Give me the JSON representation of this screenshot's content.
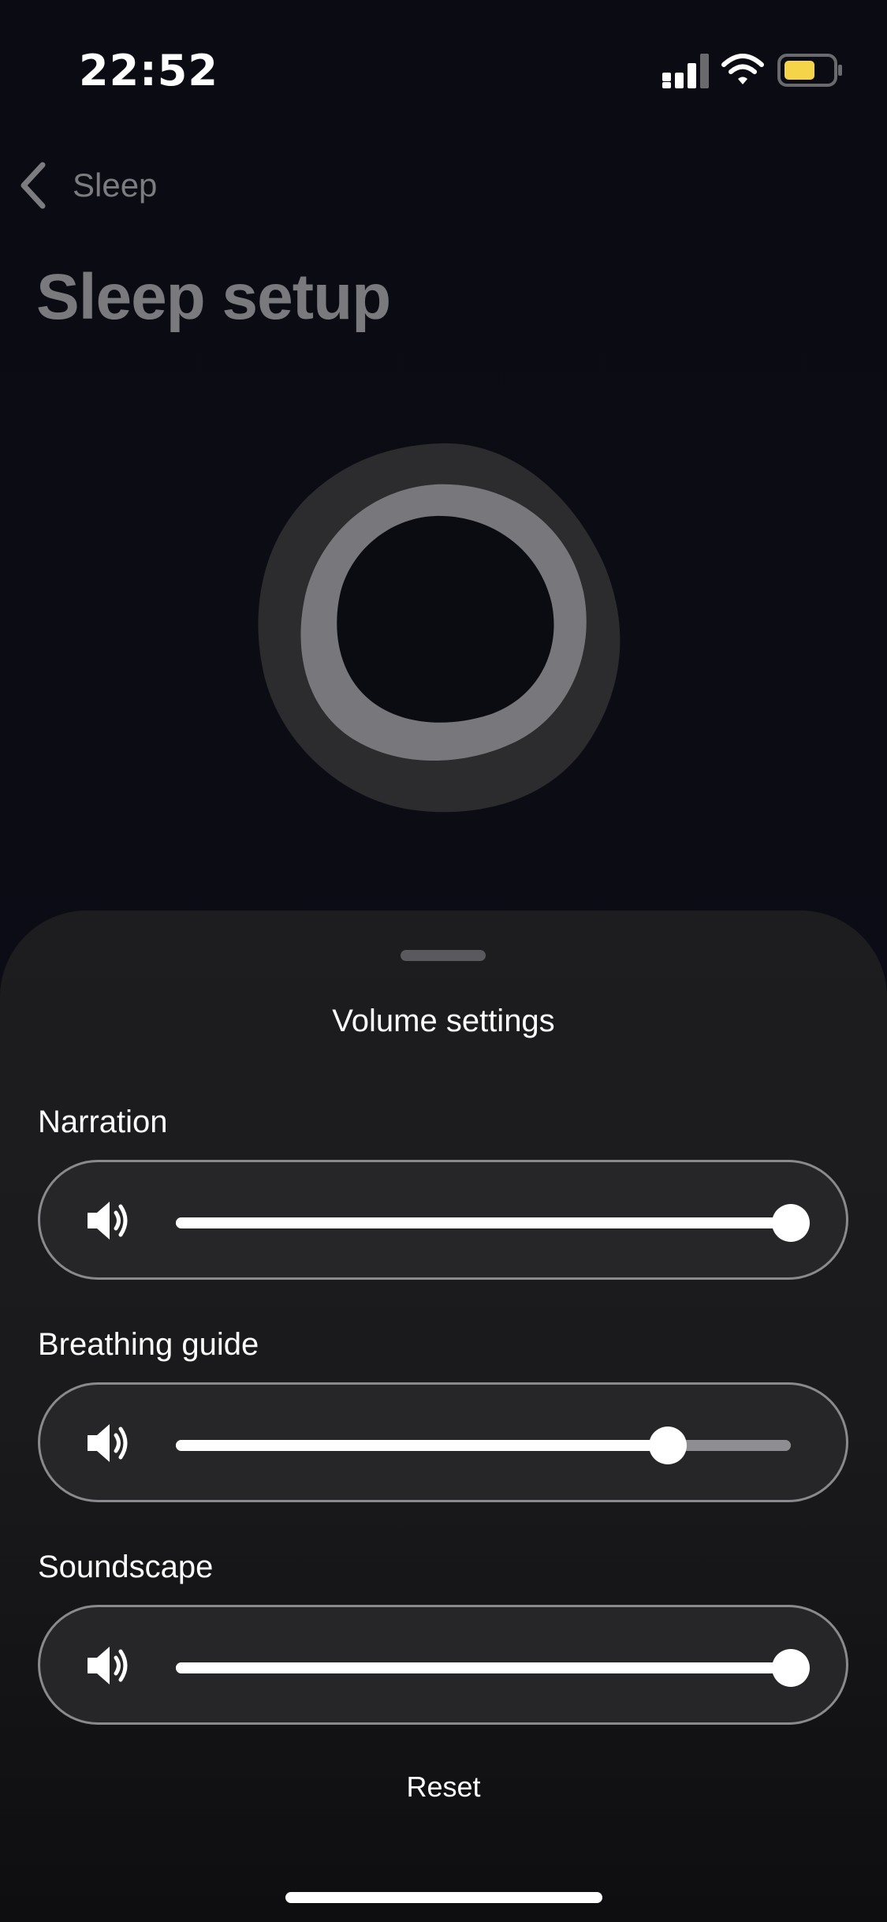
{
  "status_bar": {
    "time": "22:52",
    "battery_color": "#f5d44a"
  },
  "header": {
    "back_label": "Sleep",
    "title": "Sleep setup"
  },
  "sheet": {
    "title": "Volume settings",
    "sliders": [
      {
        "label": "Narration",
        "value_percent": 100
      },
      {
        "label": "Breathing guide",
        "value_percent": 80
      },
      {
        "label": "Soundscape",
        "value_percent": 100
      }
    ],
    "reset_label": "Reset"
  },
  "colors": {
    "background": "#0b0b13",
    "sheet": "#1c1c1e",
    "title_dim": "#7a7a7e",
    "track_inactive": "#8e8e92",
    "track_active": "#ffffff"
  }
}
